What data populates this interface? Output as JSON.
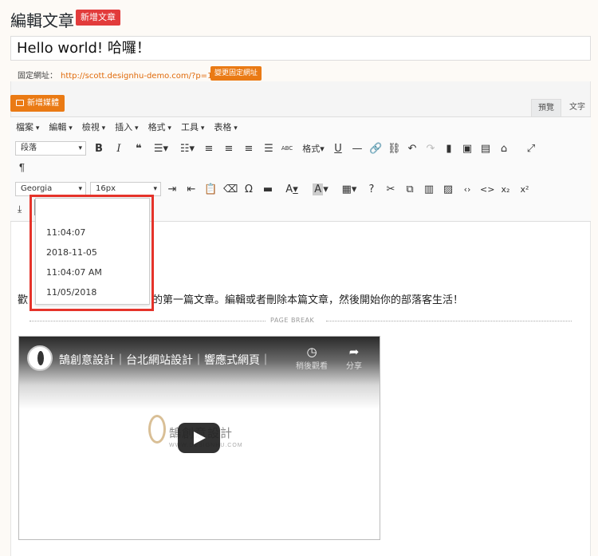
{
  "header": {
    "title": "編輯文章",
    "new_post_label": "新增文章"
  },
  "post": {
    "title": "Hello world! 哈囉！"
  },
  "permalink": {
    "label": "固定網址：",
    "url": "http://scott.designhu-demo.com/?p=1",
    "change_label": "變更固定網址"
  },
  "media": {
    "add_label": "新增媒體"
  },
  "tabs": {
    "preview": "預覽",
    "text": "文字"
  },
  "menubar": [
    "檔案",
    "編輯",
    "檢視",
    "插入",
    "格式",
    "工具",
    "表格"
  ],
  "toolbar": {
    "format_select": "段落",
    "format_menu": "格式",
    "abc": "ABC",
    "paragraph_mark": "¶",
    "font_family": "Georgia",
    "font_size": "16px",
    "omega": "Ω",
    "text_color": "A",
    "bg_color": "A",
    "subscript": "x₂",
    "superscript": "x²"
  },
  "datetime_menu": {
    "items": [
      "11:04:07",
      "2018-11-05",
      "11:04:07 AM",
      "11/05/2018"
    ]
  },
  "content": {
    "text_left": "歡",
    "text_right": "的第一篇文章。編輯或者刪除本篇文章，然後開始你的部落客生活！",
    "page_break": "PAGE BREAK"
  },
  "video": {
    "title": "鵠創意設計｜台北網站設計｜響應式網頁｜",
    "watch_later": "稍後觀看",
    "share": "分享",
    "logo_text": "鵠創意設計",
    "logo_url": "WWW.DESIGNHU.COM"
  },
  "colors": {
    "accent_red": "#e23b3b",
    "accent_orange": "#ea7a14",
    "highlight_border": "#e5332a"
  }
}
